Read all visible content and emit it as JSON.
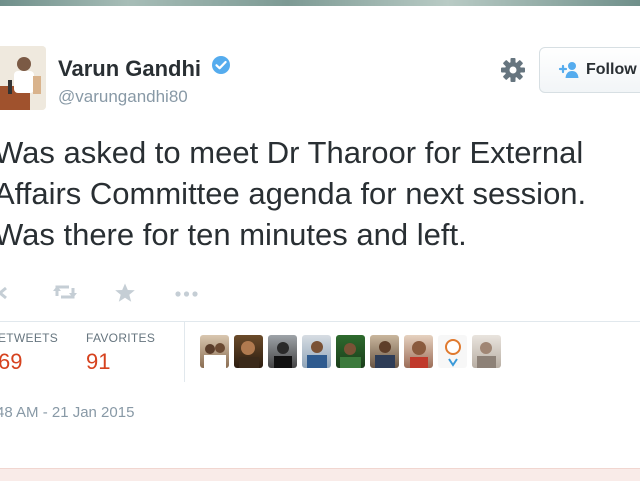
{
  "tweet": {
    "author_name": "Varun Gandhi",
    "author_handle": "@varungandhi80",
    "text_lines": [
      "Was asked to meet Dr Tharoor for External",
      "Affairs Committee agenda for next session.",
      "Was there for ten minutes and left."
    ],
    "follow_label": "Follow",
    "retweets_label": "ETWEETS",
    "retweets_value": "69",
    "favorites_label": "FAVORITES",
    "favorites_value": "91",
    "timestamp": "48 AM - 21 Jan 2015"
  },
  "icons": {
    "verified": "verified-badge-icon",
    "settings": "gear-icon",
    "follow": "add-user-icon",
    "reply": "reply-icon",
    "retweet": "retweet-icon",
    "favorite": "star-icon",
    "more": "more-icon"
  },
  "colors": {
    "accent": "#55acee",
    "stat_value": "#d6421e",
    "text": "#292f33",
    "muted": "#8899a6"
  },
  "favorited_by_count": 10
}
